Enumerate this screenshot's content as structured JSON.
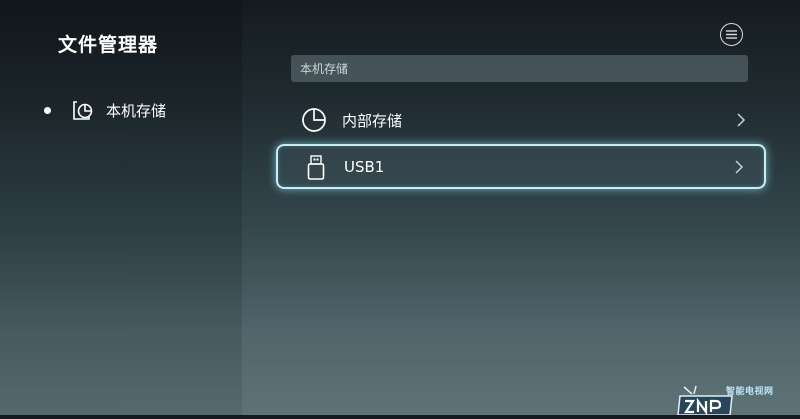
{
  "app": {
    "title": "文件管理器"
  },
  "sidebar": {
    "items": [
      {
        "label": "本机存储",
        "icon": "storage-pie-icon",
        "selected": true
      }
    ]
  },
  "header": {
    "menu_icon": "menu-icon"
  },
  "breadcrumb": {
    "path": "本机存储"
  },
  "storage_list": {
    "items": [
      {
        "label": "内部存储",
        "icon": "pie-chart-icon",
        "focused": false
      },
      {
        "label": "USB1",
        "icon": "usb-drive-icon",
        "focused": true
      }
    ]
  },
  "watermark": {
    "text": "智能电视网",
    "logo": "tv-logo-icon"
  },
  "colors": {
    "focus_border": "#c6eef3",
    "background_top": "#141b20",
    "background_bottom": "#5e7377"
  }
}
